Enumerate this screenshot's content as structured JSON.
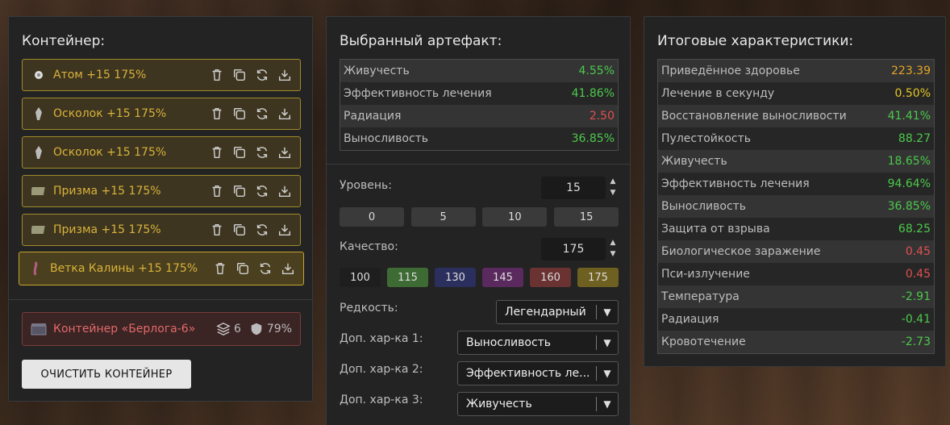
{
  "container": {
    "title": "Контейнер:",
    "artifacts": [
      {
        "name": "Атом +15 175%",
        "icon": "atom-icon"
      },
      {
        "name": "Осколок +15 175%",
        "icon": "shard-icon"
      },
      {
        "name": "Осколок +15 175%",
        "icon": "shard-icon"
      },
      {
        "name": "Призма +15 175%",
        "icon": "prism-icon"
      },
      {
        "name": "Призма +15 175%",
        "icon": "prism-icon"
      },
      {
        "name": "Ветка Калины +15 175%",
        "icon": "branch-icon"
      }
    ],
    "container_name": "Контейнер «Берлога-6»",
    "slots": "6",
    "protection": "79%",
    "clear_button": "ОЧИСТИТЬ КОНТЕЙНЕР"
  },
  "selected": {
    "title": "Выбранный артефакт:",
    "stats": [
      {
        "name": "Живучесть",
        "value": "4.55%",
        "color": "green"
      },
      {
        "name": "Эффективность лечения",
        "value": "41.86%",
        "color": "green"
      },
      {
        "name": "Радиация",
        "value": "2.50",
        "color": "red"
      },
      {
        "name": "Выносливость",
        "value": "36.85%",
        "color": "green"
      }
    ],
    "level_label": "Уровень:",
    "level_value": "15",
    "level_presets": [
      "0",
      "5",
      "10",
      "15"
    ],
    "quality_label": "Качество:",
    "quality_value": "175",
    "quality_presets": [
      {
        "label": "100",
        "color": "#1e1e1e"
      },
      {
        "label": "115",
        "color": "#3d6b33"
      },
      {
        "label": "130",
        "color": "#2b2f5e"
      },
      {
        "label": "145",
        "color": "#5a2a5e"
      },
      {
        "label": "160",
        "color": "#6b3232"
      },
      {
        "label": "175",
        "color": "#6e6020"
      }
    ],
    "rarity_label": "Редкость:",
    "rarity_value": "Легендарный",
    "extra1_label": "Доп. хар-ка 1:",
    "extra1_value": "Выносливость",
    "extra2_label": "Доп. хар-ка 2:",
    "extra2_value": "Эффективность ле...",
    "extra3_label": "Доп. хар-ка 3:",
    "extra3_value": "Живучесть"
  },
  "totals": {
    "title": "Итоговые характеристики:",
    "stats": [
      {
        "name": "Приведённое здоровье",
        "value": "223.39",
        "color": "orange"
      },
      {
        "name": "Лечение в секунду",
        "value": "0.50%",
        "color": "yellow"
      },
      {
        "name": "Восстановление выносливости",
        "value": "41.41%",
        "color": "green"
      },
      {
        "name": "Пулестойкость",
        "value": "88.27",
        "color": "green"
      },
      {
        "name": "Живучесть",
        "value": "18.65%",
        "color": "green"
      },
      {
        "name": "Эффективность лечения",
        "value": "94.64%",
        "color": "green"
      },
      {
        "name": "Выносливость",
        "value": "36.85%",
        "color": "green"
      },
      {
        "name": "Защита от взрыва",
        "value": "68.25",
        "color": "green"
      },
      {
        "name": "Биологическое заражение",
        "value": "0.45",
        "color": "red"
      },
      {
        "name": "Пси-излучение",
        "value": "0.45",
        "color": "red"
      },
      {
        "name": "Температура",
        "value": "-2.91",
        "color": "green"
      },
      {
        "name": "Радиация",
        "value": "-0.41",
        "color": "green"
      },
      {
        "name": "Кровотечение",
        "value": "-2.73",
        "color": "green"
      }
    ]
  }
}
